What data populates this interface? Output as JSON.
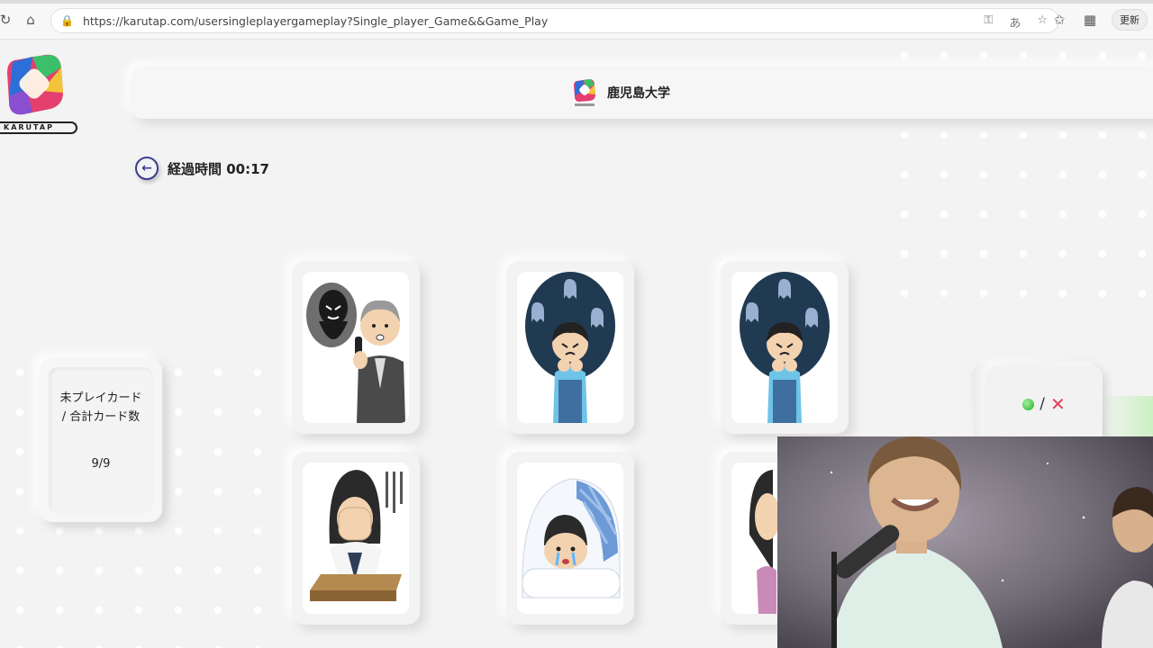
{
  "browser": {
    "url": "https://karutap.com/usersingleplayergameplay?Single_player_Game&&Game_Play",
    "update_label": "更新"
  },
  "logo": {
    "wordmark": "KARUTAP"
  },
  "header": {
    "university": "鹿児島大学"
  },
  "timer": {
    "label": "経過時間 00:17"
  },
  "counter": {
    "label": "未プレイカード / 合計カード数",
    "value": "9/9"
  },
  "score": {
    "separator": "/",
    "ng_symbol": "✕"
  },
  "colors": {
    "accent": "#3a3d8f",
    "ok": "#24b024",
    "ng": "#e0405a",
    "background": "#f3f3f3"
  },
  "cards": [
    {
      "name": "ghost-phone-call"
    },
    {
      "name": "scared-boy-ghosts"
    },
    {
      "name": "scared-boy-ghosts"
    },
    {
      "name": "depressed-at-desk"
    },
    {
      "name": "crying-under-blanket"
    },
    {
      "name": "partial-person"
    }
  ]
}
